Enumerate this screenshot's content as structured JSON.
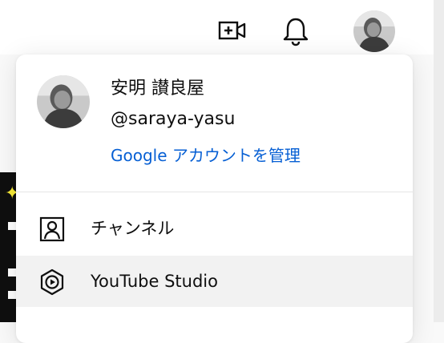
{
  "account": {
    "name": "安明 讃良屋",
    "handle": "@saraya-yasu",
    "manage_label": "Google アカウントを管理"
  },
  "menu": {
    "items": [
      {
        "label": "チャンネル",
        "icon": "person-box-icon"
      },
      {
        "label": "YouTube Studio",
        "icon": "youtube-studio-icon"
      }
    ]
  },
  "topbar": {
    "icons": [
      "create-video-icon",
      "notifications-bell-icon",
      "account-avatar"
    ]
  },
  "colors": {
    "link": "#065fd4",
    "hover_row": "#f2f2f2",
    "divider": "#e5e5e5",
    "background_accent": "#f7ea37"
  }
}
